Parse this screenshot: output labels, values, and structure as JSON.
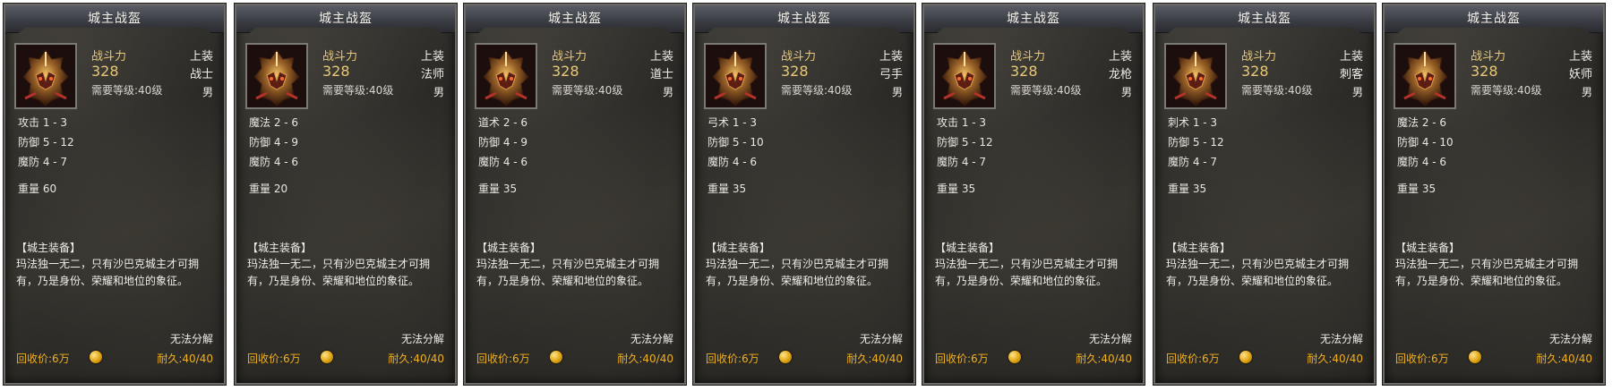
{
  "cards": [
    {
      "title": "城主战盔",
      "power_label": "战斗力",
      "power": "328",
      "level_req": "需要等级:40级",
      "slot": "上装",
      "class": "战士",
      "gender": "男",
      "stats": [
        "攻击 1 - 3",
        "防御 5 - 12",
        "魔防 4 - 7"
      ],
      "weight": "重量 60",
      "set_title": "【城主装备】",
      "description": "玛法独一无二，只有沙巴克城主才可拥有，乃是身份、荣耀和地位的象征。",
      "no_decompose": "无法分解",
      "recycle": "回收价:6万",
      "durability": "耐久:40/40"
    },
    {
      "title": "城主战盔",
      "power_label": "战斗力",
      "power": "328",
      "level_req": "需要等级:40级",
      "slot": "上装",
      "class": "法师",
      "gender": "男",
      "stats": [
        "魔法 2 - 6",
        "防御 4 - 9",
        "魔防 4 - 6"
      ],
      "weight": "重量 20",
      "set_title": "【城主装备】",
      "description": "玛法独一无二，只有沙巴克城主才可拥有，乃是身份、荣耀和地位的象征。",
      "no_decompose": "无法分解",
      "recycle": "回收价:6万",
      "durability": "耐久:40/40"
    },
    {
      "title": "城主战盔",
      "power_label": "战斗力",
      "power": "328",
      "level_req": "需要等级:40级",
      "slot": "上装",
      "class": "道士",
      "gender": "男",
      "stats": [
        "道术 2 - 6",
        "防御 4 - 9",
        "魔防 4 - 6"
      ],
      "weight": "重量 35",
      "set_title": "【城主装备】",
      "description": "玛法独一无二，只有沙巴克城主才可拥有，乃是身份、荣耀和地位的象征。",
      "no_decompose": "无法分解",
      "recycle": "回收价:6万",
      "durability": "耐久:40/40"
    },
    {
      "title": "城主战盔",
      "power_label": "战斗力",
      "power": "328",
      "level_req": "需要等级:40级",
      "slot": "上装",
      "class": "弓手",
      "gender": "男",
      "stats": [
        "弓术 1 - 3",
        "防御 5 - 10",
        "魔防 4 - 6"
      ],
      "weight": "重量 35",
      "set_title": "【城主装备】",
      "description": "玛法独一无二，只有沙巴克城主才可拥有，乃是身份、荣耀和地位的象征。",
      "no_decompose": "无法分解",
      "recycle": "回收价:6万",
      "durability": "耐久:40/40"
    },
    {
      "title": "城主战盔",
      "power_label": "战斗力",
      "power": "328",
      "level_req": "需要等级:40级",
      "slot": "上装",
      "class": "龙枪",
      "gender": "男",
      "stats": [
        "攻击 1 - 3",
        "防御 5 - 12",
        "魔防 4 - 7"
      ],
      "weight": "重量 35",
      "set_title": "【城主装备】",
      "description": "玛法独一无二，只有沙巴克城主才可拥有，乃是身份、荣耀和地位的象征。",
      "no_decompose": "无法分解",
      "recycle": "回收价:6万",
      "durability": "耐久:40/40"
    },
    {
      "title": "城主战盔",
      "power_label": "战斗力",
      "power": "328",
      "level_req": "需要等级:40级",
      "slot": "上装",
      "class": "刺客",
      "gender": "男",
      "stats": [
        "刺术 1 - 3",
        "防御 5 - 12",
        "魔防 4 - 7"
      ],
      "weight": "重量 35",
      "set_title": "【城主装备】",
      "description": "玛法独一无二，只有沙巴克城主才可拥有，乃是身份、荣耀和地位的象征。",
      "no_decompose": "无法分解",
      "recycle": "回收价:6万",
      "durability": "耐久:40/40"
    },
    {
      "title": "城主战盔",
      "power_label": "战斗力",
      "power": "328",
      "level_req": "需要等级:40级",
      "slot": "上装",
      "class": "妖师",
      "gender": "男",
      "stats": [
        "魔法 2 - 6",
        "防御 4 - 10",
        "魔防 4 - 6"
      ],
      "weight": "重量 35",
      "set_title": "【城主装备】",
      "description": "玛法独一无二，只有沙巴克城主才可拥有，乃是身份、荣耀和地位的象征。",
      "no_decompose": "无法分解",
      "recycle": "回收价:6万",
      "durability": "耐久:40/40"
    }
  ]
}
